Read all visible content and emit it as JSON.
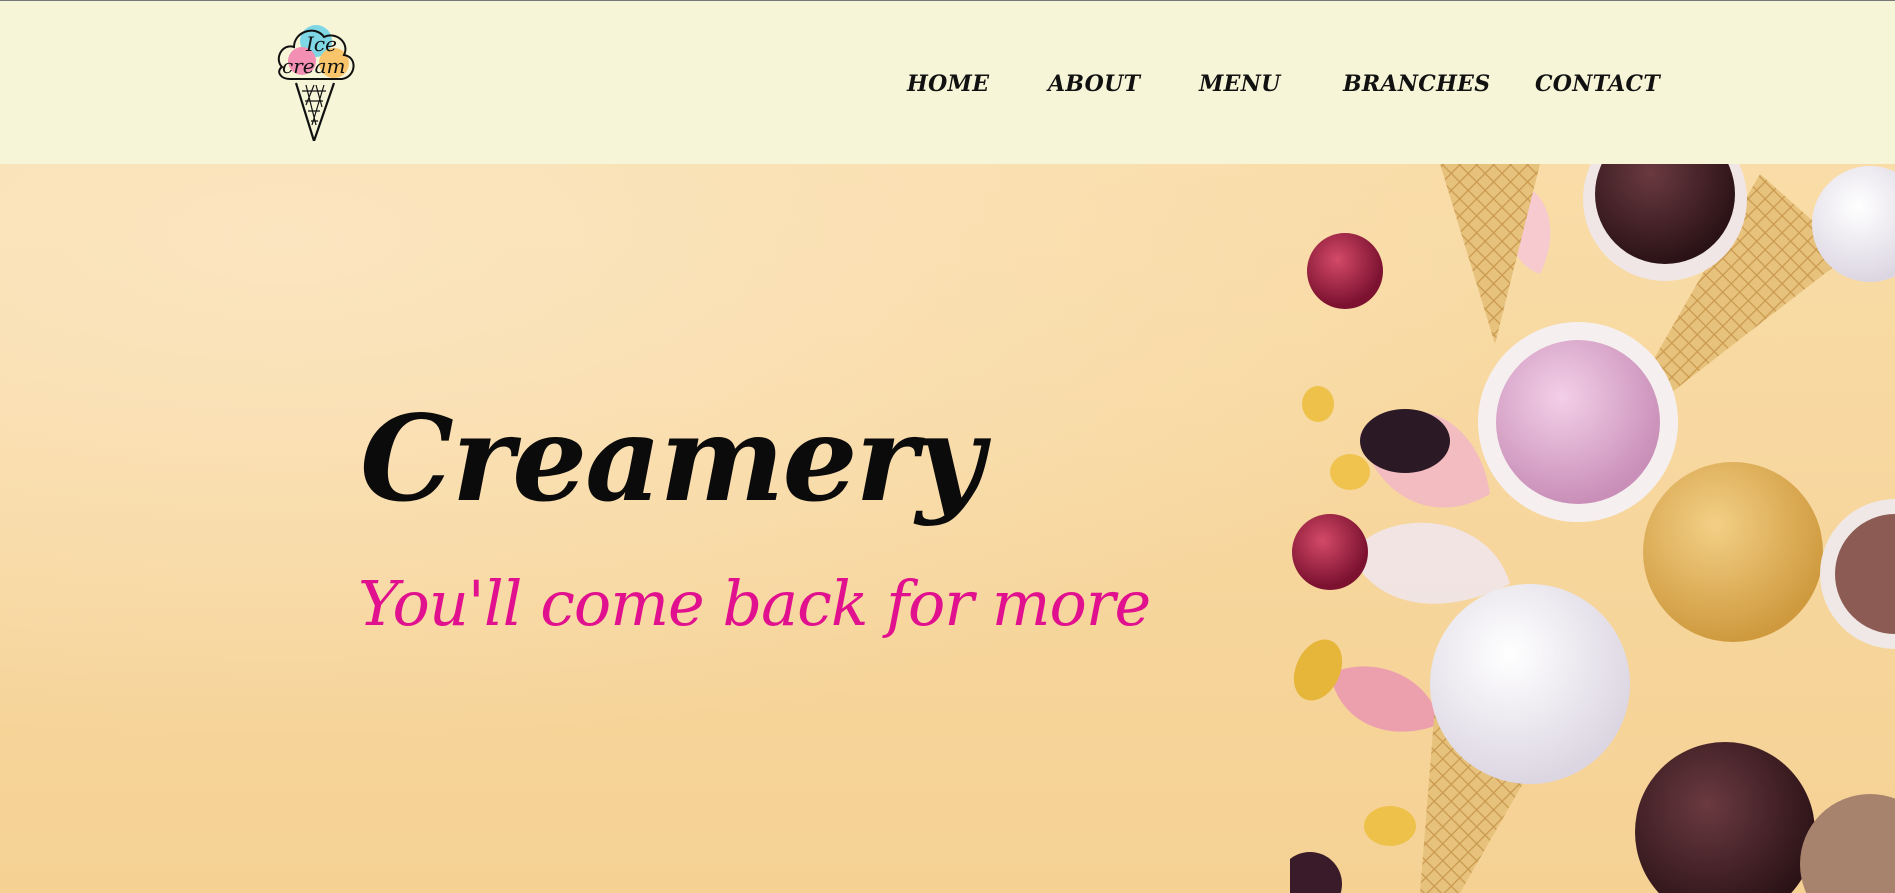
{
  "brand": {
    "logo_line1": "Ice",
    "logo_line2": "cream",
    "logo_icon": "ice-cream-cone-logo"
  },
  "nav": {
    "items": [
      {
        "label": "HOME"
      },
      {
        "label": "ABOUT"
      },
      {
        "label": "MENU"
      },
      {
        "label": "BRANCHES"
      },
      {
        "label": "CONTACT"
      }
    ]
  },
  "hero": {
    "title": "Creamery",
    "tagline": "You'll come back for more",
    "image": "ice-cream-cones-and-berries-photo"
  },
  "colors": {
    "header_bg": "#f7f5d8",
    "hero_bg": "#f7d69c",
    "title": "#0b0b0b",
    "tagline": "#e0108e",
    "nav_text": "#111111"
  }
}
